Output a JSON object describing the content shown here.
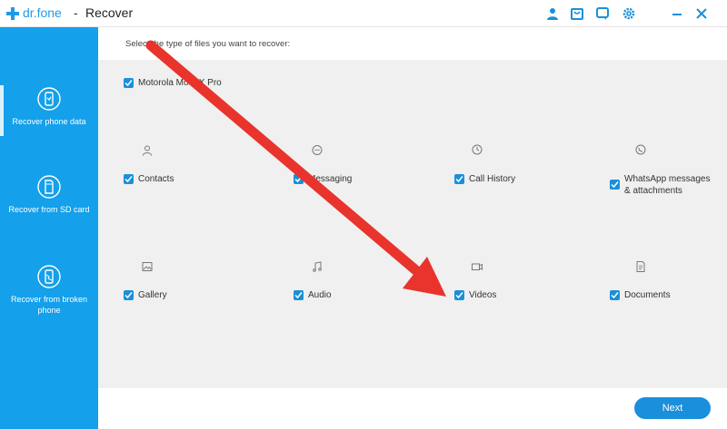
{
  "app": {
    "brand": "dr.fone",
    "separator": "-",
    "title": "Recover"
  },
  "sidebar": {
    "items": [
      {
        "label": "Recover phone data"
      },
      {
        "label": "Recover from SD card"
      },
      {
        "label": "Recover from broken phone"
      }
    ]
  },
  "main": {
    "prompt": "Select the type of files you want to recover:",
    "select_all_label": "Motorola Moto X Pro",
    "categories": [
      {
        "label": "Contacts",
        "icon": "person-icon",
        "checked": true
      },
      {
        "label": "Messaging",
        "icon": "message-icon",
        "checked": true
      },
      {
        "label": "Call History",
        "icon": "clock-icon",
        "checked": true
      },
      {
        "label": "WhatsApp messages & attachments",
        "icon": "whatsapp-icon",
        "checked": true
      },
      {
        "label": "Gallery",
        "icon": "image-icon",
        "checked": true
      },
      {
        "label": "Audio",
        "icon": "music-note-icon",
        "checked": true
      },
      {
        "label": "Videos",
        "icon": "video-icon",
        "checked": true
      },
      {
        "label": "Documents",
        "icon": "document-icon",
        "checked": true
      }
    ]
  },
  "footer": {
    "next_label": "Next"
  },
  "colors": {
    "sidebar": "#14a0ea",
    "accent": "#1a8fdb",
    "annotation_arrow": "#e8342c"
  }
}
